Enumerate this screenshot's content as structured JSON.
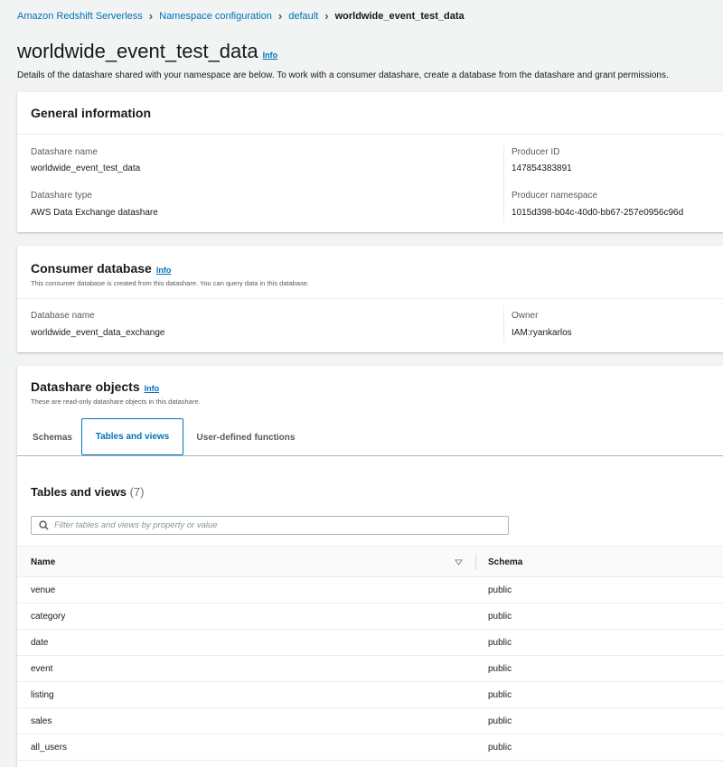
{
  "breadcrumb": {
    "items": [
      "Amazon Redshift Serverless",
      "Namespace configuration",
      "default"
    ],
    "current": "worldwide_event_test_data"
  },
  "page": {
    "title": "worldwide_event_test_data",
    "info": "Info",
    "description": "Details of the datashare shared with your namespace are below. To work with a consumer datashare, create a database from the datashare and grant permissions."
  },
  "general": {
    "title": "General information",
    "datashare_name_label": "Datashare name",
    "datashare_name": "worldwide_event_test_data",
    "datashare_type_label": "Datashare type",
    "datashare_type": "AWS Data Exchange datashare",
    "producer_id_label": "Producer ID",
    "producer_id": "147854383891",
    "producer_namespace_label": "Producer namespace",
    "producer_namespace": "1015d398-b04c-40d0-bb67-257e0956c96d"
  },
  "consumer": {
    "title": "Consumer database",
    "info": "Info",
    "subtitle": "This consumer database is created from this datashare. You can query data in this database.",
    "database_name_label": "Database name",
    "database_name": "worldwide_event_data_exchange",
    "owner_label": "Owner",
    "owner": "IAM:ryankarlos"
  },
  "objects": {
    "title": "Datashare objects",
    "info": "Info",
    "subtitle": "These are read-only datashare objects in this datashare.",
    "tabs": [
      "Schemas",
      "Tables and views",
      "User-defined functions"
    ],
    "active_tab": 1,
    "table_title": "Tables and views",
    "table_count": "(7)",
    "search_placeholder": "Filter tables and views by property or value",
    "columns": [
      "Name",
      "Schema"
    ],
    "rows": [
      {
        "name": "venue",
        "schema": "public"
      },
      {
        "name": "category",
        "schema": "public"
      },
      {
        "name": "date",
        "schema": "public"
      },
      {
        "name": "event",
        "schema": "public"
      },
      {
        "name": "listing",
        "schema": "public"
      },
      {
        "name": "sales",
        "schema": "public"
      },
      {
        "name": "all_users",
        "schema": "public"
      }
    ]
  },
  "colors": {
    "link": "#0073bb",
    "background": "#f2f3f3",
    "text": "#16191f"
  }
}
